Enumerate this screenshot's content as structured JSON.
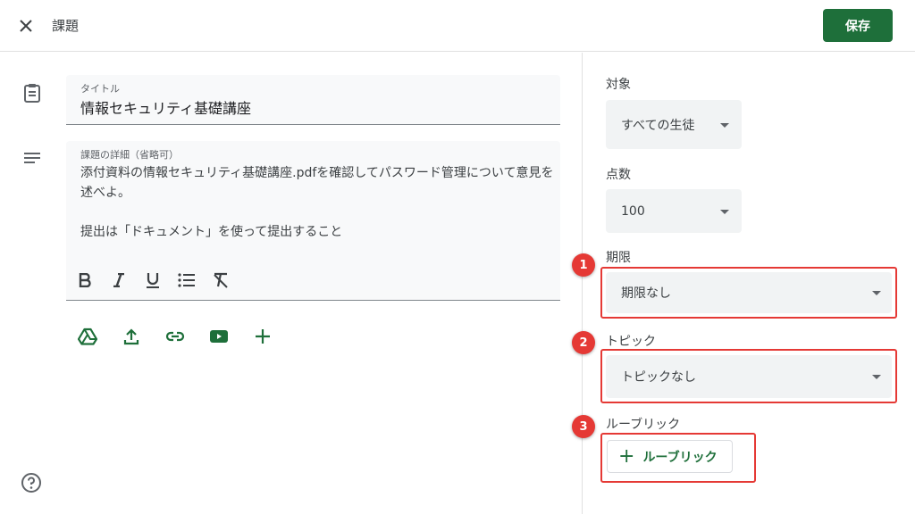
{
  "header": {
    "title": "課題",
    "save_label": "保存"
  },
  "title_field": {
    "label": "タイトル",
    "value": "情報セキュリティ基礎講座"
  },
  "details_field": {
    "label": "課題の詳細（省略可）",
    "value": "添付資料の情報セキュリティ基礎講座.pdfを確認してパスワード管理について意見を述べよ。\n\n提出は「ドキュメント」を使って提出すること"
  },
  "format_toolbar": [
    "bold-icon",
    "italic-icon",
    "underline-icon",
    "bulleted-list-icon",
    "clear-formatting-icon"
  ],
  "attachments": [
    "google-drive-icon",
    "upload-icon",
    "link-icon",
    "youtube-icon",
    "add-icon"
  ],
  "assign_to": {
    "label": "対象",
    "value": "すべての生徒"
  },
  "points": {
    "label": "点数",
    "value": "100"
  },
  "due": {
    "label": "期限",
    "value": "期限なし",
    "badge": "1"
  },
  "topic": {
    "label": "トピック",
    "value": "トピックなし",
    "badge": "2"
  },
  "rubric": {
    "label": "ルーブリック",
    "button_label": "ルーブリック",
    "badge": "3"
  },
  "colors": {
    "accent": "#1e6f3a",
    "highlight": "#e53935",
    "field_bg": "#f8f9fa",
    "select_bg": "#f1f3f4"
  }
}
